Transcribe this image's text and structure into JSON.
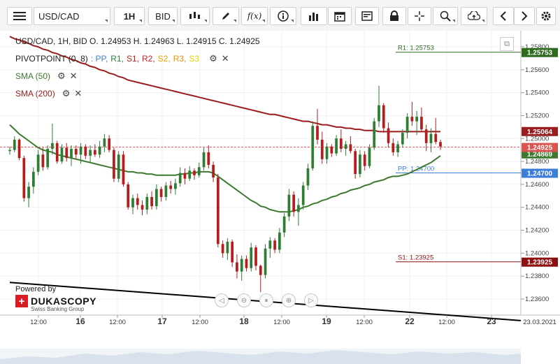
{
  "toolbar": {
    "menu_icon": "hamburger-icon",
    "symbol": "USD/CAD",
    "timeframe": "1H",
    "price_side": "BID",
    "tools": [
      "candles-icon",
      "pencil-icon",
      "fx-icon",
      "info-icon",
      "bars-icon",
      "calendar-icon",
      "report-icon",
      "lock-icon",
      "crosshair-icon",
      "zoom-icon",
      "upload-icon",
      "arrow-left-icon",
      "arrow-right-icon",
      "gear-icon"
    ]
  },
  "legend": {
    "ohlc": "USD/CAD, 1H, BID    O. 1.24953 H. 1.24963 L. 1.24915 C. 1.24925",
    "pivot_label": "PIVOTPOINT (0, 8)",
    "pivot_items": [
      {
        "text": ": PP,",
        "color": "#3b7dd8"
      },
      {
        "text": "R1,",
        "color": "#2e7d32"
      },
      {
        "text": "S1,",
        "color": "#b22222"
      },
      {
        "text": "R2,",
        "color": "#cc2222"
      },
      {
        "text": "S2,",
        "color": "#e6a100"
      },
      {
        "text": "R3,",
        "color": "#f09000"
      },
      {
        "text": "S3",
        "color": "#e6d000"
      }
    ],
    "sma50": "SMA (50)",
    "sma200": "SMA (200)"
  },
  "branding": {
    "powered": "Powered by",
    "name": "DUKASCOPY",
    "sub": "Swiss Banking Group"
  },
  "colors": {
    "up": "#2e7d32",
    "down": "#b71c1c",
    "sma50": "#3c7a2e",
    "sma200": "#9b1c1c",
    "pp": "#3b7dd8",
    "r1": "#2e6b1f",
    "s1": "#8b1010",
    "trend": "#000000"
  },
  "chart_data": {
    "type": "candlestick",
    "symbol": "USD/CAD",
    "interval": "1H",
    "ylim": [
      1.2346,
      1.2594
    ],
    "y_ticks": [
      "1.25800",
      "1.25600",
      "1.25400",
      "1.25200",
      "1.25000",
      "1.24800",
      "1.24600",
      "1.24400",
      "1.24200",
      "1.24000",
      "1.23800",
      "1.23600"
    ],
    "x_ticks": [
      "12:00",
      "16",
      "12:00",
      "17",
      "12:00",
      "18",
      "12:00",
      "19",
      "12:00",
      "22",
      "12:00",
      "23",
      "23.03.2021"
    ],
    "levels": [
      {
        "name": "R1",
        "label": "R1: 1.25753",
        "value": 1.25753,
        "color": "#2e6b1f",
        "badge": "1.25753"
      },
      {
        "name": "PP",
        "label": "PP: 1.24700",
        "value": 1.247,
        "color": "#3b7dd8",
        "badge": "1.24700"
      },
      {
        "name": "S1",
        "label": "S1: 1.23925",
        "value": 1.23925,
        "color": "#8b1010",
        "badge": "1.23925"
      }
    ],
    "current_price": {
      "value": 1.24925,
      "label": "1.24925",
      "color": "#d9534f"
    },
    "sma200_last": {
      "value": 1.25064,
      "label": "1.25064"
    },
    "sma50_last": {
      "value": 1.24869,
      "label": "1.24869"
    },
    "candles": [
      [
        1.2489,
        1.2493,
        1.2486,
        1.249
      ],
      [
        1.249,
        1.2502,
        1.2488,
        1.2499
      ],
      [
        1.2499,
        1.25,
        1.2481,
        1.2483
      ],
      [
        1.2483,
        1.2485,
        1.2445,
        1.2448
      ],
      [
        1.2448,
        1.2462,
        1.244,
        1.2458
      ],
      [
        1.2458,
        1.2475,
        1.2452,
        1.2471
      ],
      [
        1.2471,
        1.249,
        1.2468,
        1.2486
      ],
      [
        1.2486,
        1.2492,
        1.2472,
        1.2475
      ],
      [
        1.2475,
        1.2494,
        1.2473,
        1.2491
      ],
      [
        1.2491,
        1.2513,
        1.2486,
        1.2496
      ],
      [
        1.2496,
        1.2498,
        1.2478,
        1.248
      ],
      [
        1.248,
        1.2495,
        1.2478,
        1.2492
      ],
      [
        1.2492,
        1.2496,
        1.248,
        1.2483
      ],
      [
        1.2483,
        1.2494,
        1.2476,
        1.2491
      ],
      [
        1.2491,
        1.2494,
        1.2482,
        1.2486
      ],
      [
        1.2486,
        1.2496,
        1.2478,
        1.2493
      ],
      [
        1.2493,
        1.2495,
        1.2482,
        1.2485
      ],
      [
        1.2485,
        1.2494,
        1.2479,
        1.249
      ],
      [
        1.249,
        1.2495,
        1.2484,
        1.2486
      ],
      [
        1.2486,
        1.2498,
        1.2483,
        1.2493
      ],
      [
        1.2493,
        1.2504,
        1.2488,
        1.25
      ],
      [
        1.25,
        1.2503,
        1.2488,
        1.249
      ],
      [
        1.249,
        1.2492,
        1.2462,
        1.2465
      ],
      [
        1.2465,
        1.2489,
        1.2462,
        1.2486
      ],
      [
        1.2486,
        1.2489,
        1.2458,
        1.246
      ],
      [
        1.246,
        1.2462,
        1.2438,
        1.244
      ],
      [
        1.244,
        1.2451,
        1.2434,
        1.2448
      ],
      [
        1.2448,
        1.2452,
        1.2438,
        1.2442
      ],
      [
        1.2442,
        1.2446,
        1.2433,
        1.2438
      ],
      [
        1.2438,
        1.2452,
        1.2434,
        1.2449
      ],
      [
        1.2449,
        1.2454,
        1.2438,
        1.2441
      ],
      [
        1.2441,
        1.246,
        1.2438,
        1.2456
      ],
      [
        1.2456,
        1.2458,
        1.2445,
        1.2449
      ],
      [
        1.2449,
        1.2462,
        1.2446,
        1.2459
      ],
      [
        1.2459,
        1.2463,
        1.2452,
        1.2456
      ],
      [
        1.2456,
        1.2465,
        1.2451,
        1.2461
      ],
      [
        1.2461,
        1.2475,
        1.2458,
        1.247
      ],
      [
        1.247,
        1.2474,
        1.246,
        1.2465
      ],
      [
        1.2465,
        1.2476,
        1.2463,
        1.2472
      ],
      [
        1.2472,
        1.2474,
        1.2464,
        1.2468
      ],
      [
        1.2468,
        1.2479,
        1.2466,
        1.2475
      ],
      [
        1.2475,
        1.2492,
        1.2472,
        1.2488
      ],
      [
        1.2488,
        1.2494,
        1.2474,
        1.2477
      ],
      [
        1.2477,
        1.248,
        1.2462,
        1.2466
      ],
      [
        1.2466,
        1.2469,
        1.2405,
        1.2408
      ],
      [
        1.2408,
        1.2411,
        1.2396,
        1.24
      ],
      [
        1.24,
        1.2413,
        1.2394,
        1.241
      ],
      [
        1.241,
        1.2412,
        1.2388,
        1.2392
      ],
      [
        1.2392,
        1.2399,
        1.2378,
        1.2384
      ],
      [
        1.2384,
        1.2398,
        1.2376,
        1.2395
      ],
      [
        1.2395,
        1.2398,
        1.2384,
        1.2387
      ],
      [
        1.2387,
        1.2409,
        1.2384,
        1.2405
      ],
      [
        1.2405,
        1.2407,
        1.2385,
        1.2389
      ],
      [
        1.2389,
        1.239,
        1.2366,
        1.2381
      ],
      [
        1.2381,
        1.2408,
        1.2378,
        1.2404
      ],
      [
        1.2404,
        1.2414,
        1.2396,
        1.2411
      ],
      [
        1.2411,
        1.2413,
        1.24,
        1.2403
      ],
      [
        1.2403,
        1.2422,
        1.24,
        1.2418
      ],
      [
        1.2418,
        1.2435,
        1.2414,
        1.2432
      ],
      [
        1.2432,
        1.2456,
        1.2428,
        1.2451
      ],
      [
        1.2451,
        1.2454,
        1.2432,
        1.2436
      ],
      [
        1.2436,
        1.2448,
        1.2424,
        1.2442
      ],
      [
        1.2442,
        1.2462,
        1.2438,
        1.2459
      ],
      [
        1.2459,
        1.2478,
        1.2455,
        1.2474
      ],
      [
        1.2474,
        1.2515,
        1.2472,
        1.2511
      ],
      [
        1.2511,
        1.2526,
        1.2495,
        1.2499
      ],
      [
        1.2499,
        1.2506,
        1.2478,
        1.2482
      ],
      [
        1.2482,
        1.2496,
        1.2478,
        1.2493
      ],
      [
        1.2493,
        1.2495,
        1.2484,
        1.2487
      ],
      [
        1.2487,
        1.2503,
        1.2485,
        1.25
      ],
      [
        1.25,
        1.2508,
        1.2488,
        1.2491
      ],
      [
        1.2491,
        1.2498,
        1.2485,
        1.2495
      ],
      [
        1.2495,
        1.2502,
        1.2487,
        1.2489
      ],
      [
        1.2489,
        1.2491,
        1.2465,
        1.2469
      ],
      [
        1.2469,
        1.249,
        1.2466,
        1.2486
      ],
      [
        1.2486,
        1.2489,
        1.2472,
        1.2476
      ],
      [
        1.2476,
        1.2495,
        1.2474,
        1.2492
      ],
      [
        1.2492,
        1.2518,
        1.249,
        1.2515
      ],
      [
        1.2515,
        1.2546,
        1.251,
        1.2529
      ],
      [
        1.2529,
        1.2531,
        1.2505,
        1.2509
      ],
      [
        1.2509,
        1.2514,
        1.2492,
        1.2496
      ],
      [
        1.2496,
        1.25,
        1.2485,
        1.2488
      ],
      [
        1.2488,
        1.2498,
        1.2484,
        1.2495
      ],
      [
        1.2495,
        1.2508,
        1.2492,
        1.2505
      ],
      [
        1.2505,
        1.2522,
        1.25,
        1.2519
      ],
      [
        1.2519,
        1.2532,
        1.2511,
        1.2515
      ],
      [
        1.2515,
        1.2524,
        1.2503,
        1.2519
      ],
      [
        1.2519,
        1.2527,
        1.2506,
        1.2508
      ],
      [
        1.2508,
        1.2512,
        1.2489,
        1.2496
      ],
      [
        1.2496,
        1.2509,
        1.2488,
        1.2504
      ],
      [
        1.2504,
        1.2518,
        1.2495,
        1.2497
      ],
      [
        1.2497,
        1.2499,
        1.249,
        1.2493
      ]
    ],
    "sma50": [
      1.2512,
      1.2508,
      1.2504,
      1.2501,
      1.2498,
      1.2495,
      1.2492,
      1.249,
      1.2489,
      1.2488,
      1.2486,
      1.2485,
      1.2484,
      1.2483,
      1.2482,
      1.2481,
      1.248,
      1.2479,
      1.2478,
      1.2477,
      1.2476,
      1.2475,
      1.2474,
      1.2473,
      1.2472,
      1.2471,
      1.2471,
      1.247,
      1.247,
      1.2469,
      1.2469,
      1.2468,
      1.2468,
      1.2468,
      1.2468,
      1.2468,
      1.2469,
      1.2469,
      1.247,
      1.247,
      1.2471,
      1.2471,
      1.2471,
      1.247,
      1.2467,
      1.2464,
      1.2461,
      1.2458,
      1.2455,
      1.2452,
      1.2449,
      1.2446,
      1.2444,
      1.2441,
      1.244,
      1.2438,
      1.2437,
      1.2436,
      1.2436,
      1.2436,
      1.2437,
      1.2438,
      1.244,
      1.2441,
      1.2443,
      1.2444,
      1.2446,
      1.2447,
      1.2449,
      1.245,
      1.2452,
      1.2453,
      1.2455,
      1.2456,
      1.2457,
      1.2459,
      1.246,
      1.2462,
      1.2463,
      1.2464,
      1.2466,
      1.2467,
      1.2467,
      1.2468,
      1.2469,
      1.2471,
      1.2473,
      1.2475,
      1.2477,
      1.2479,
      1.2482,
      1.2485
    ],
    "sma200": [
      1.2589,
      1.2587,
      1.2586,
      1.2584,
      1.2583,
      1.2581,
      1.258,
      1.2578,
      1.2577,
      1.2575,
      1.2574,
      1.2572,
      1.2571,
      1.2569,
      1.2568,
      1.2566,
      1.2565,
      1.2563,
      1.2562,
      1.256,
      1.2559,
      1.2557,
      1.2556,
      1.2554,
      1.2553,
      1.2551,
      1.255,
      1.2549,
      1.2548,
      1.2547,
      1.2546,
      1.2545,
      1.2544,
      1.2543,
      1.2542,
      1.2541,
      1.254,
      1.2539,
      1.2538,
      1.2537,
      1.2536,
      1.2535,
      1.2534,
      1.2533,
      1.2532,
      1.2531,
      1.253,
      1.2529,
      1.2528,
      1.2527,
      1.2526,
      1.2525,
      1.2524,
      1.2523,
      1.2522,
      1.2521,
      1.2521,
      1.252,
      1.2519,
      1.2518,
      1.2517,
      1.2516,
      1.2515,
      1.2515,
      1.2514,
      1.2513,
      1.2512,
      1.2512,
      1.2511,
      1.251,
      1.251,
      1.2509,
      1.2509,
      1.2508,
      1.2508,
      1.2507,
      1.2507,
      1.2507,
      1.2506,
      1.2506,
      1.2506,
      1.2506,
      1.2506,
      1.2506,
      1.2506,
      1.2506,
      1.2506,
      1.2506,
      1.2506,
      1.2506,
      1.2506,
      1.2506
    ],
    "trendline": [
      [
        0,
        1.23745
      ],
      [
        91,
        1.23485
      ]
    ]
  }
}
